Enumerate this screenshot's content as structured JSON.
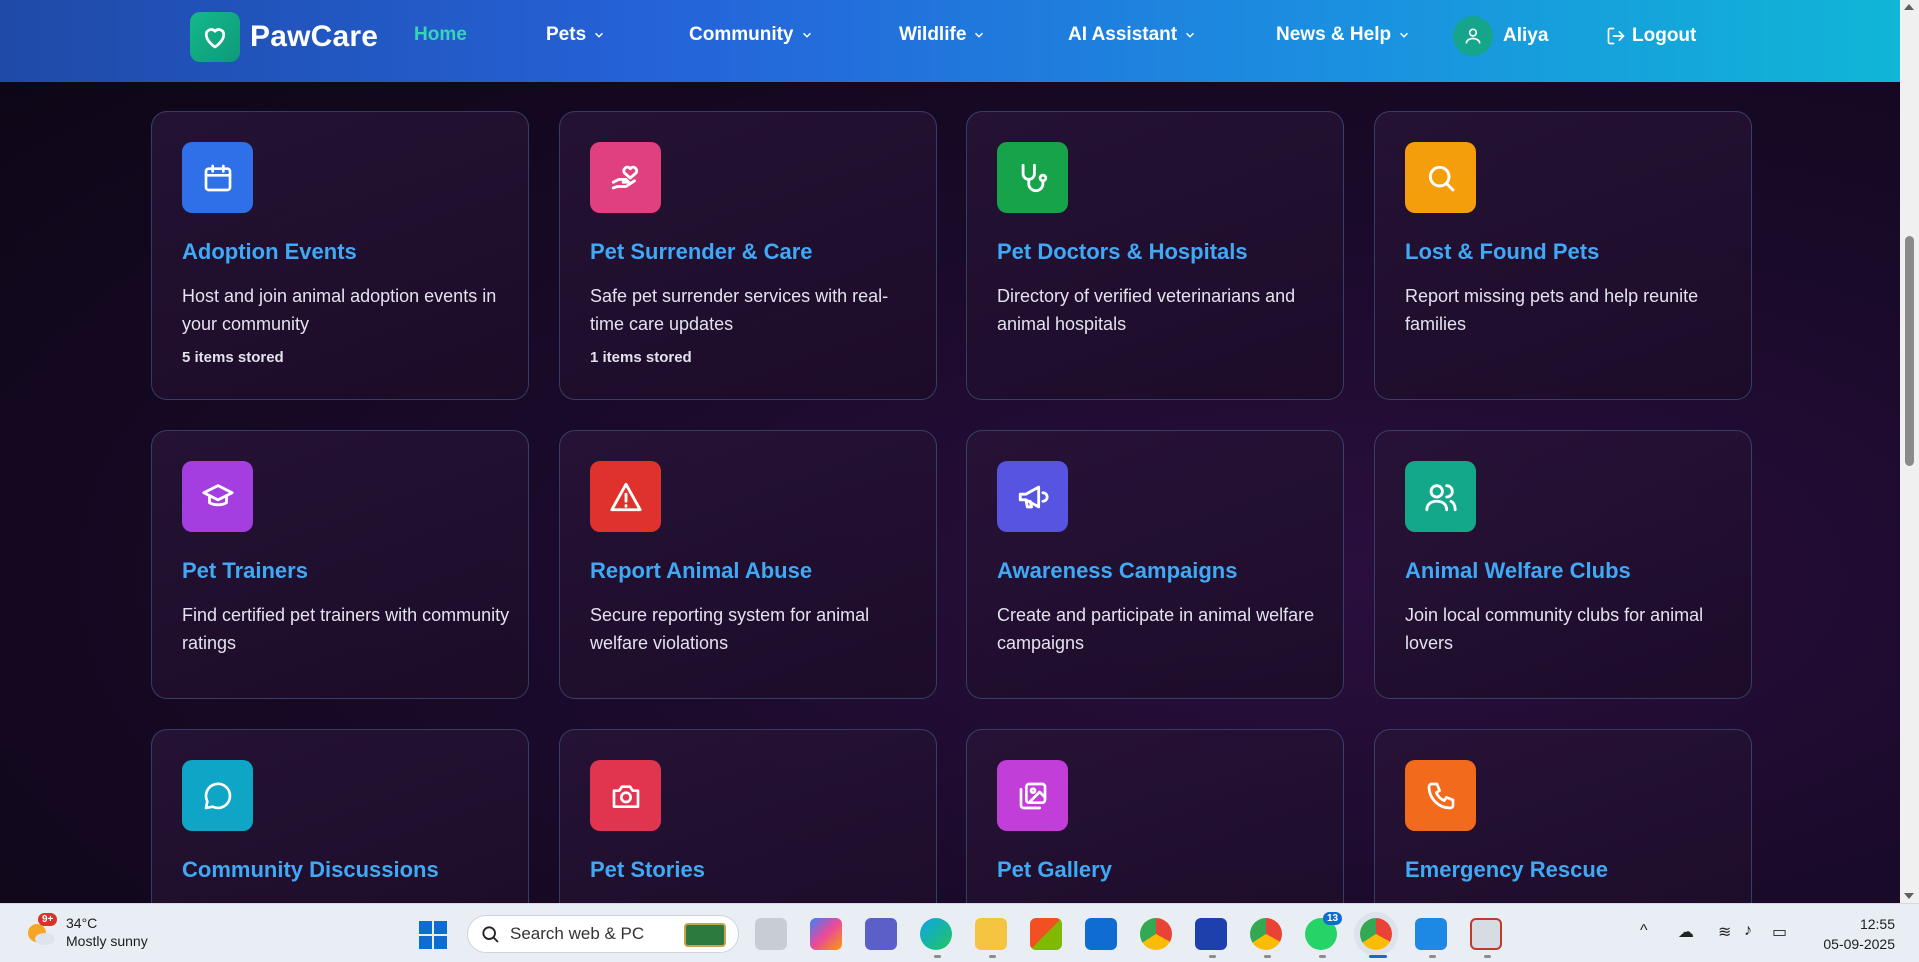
{
  "nav": {
    "brand": "PawCare",
    "items": [
      {
        "label": "Home",
        "active": true
      },
      {
        "label": "Pets"
      },
      {
        "label": "Community"
      },
      {
        "label": "Wildlife"
      },
      {
        "label": "AI Assistant"
      },
      {
        "label": "News & Help"
      }
    ],
    "user": "Aliya",
    "logout": "Logout"
  },
  "cards": [
    {
      "title": "Adoption Events",
      "desc": "Host and join animal adoption events in your community",
      "count": "5 items stored",
      "icon": "calendar-icon",
      "color": "#2f6fe8"
    },
    {
      "title": "Pet Surrender & Care",
      "desc": "Safe pet surrender services with real-time care updates",
      "count": "1 items stored",
      "icon": "heart-hand-icon",
      "color": "#e0407f"
    },
    {
      "title": "Pet Doctors & Hospitals",
      "desc": "Directory of verified veterinarians and animal hospitals",
      "icon": "stethoscope-icon",
      "color": "#16a34a"
    },
    {
      "title": "Lost & Found Pets",
      "desc": "Report missing pets and help reunite families",
      "icon": "search-icon",
      "color": "#f59e0b"
    },
    {
      "title": "Pet Trainers",
      "desc": "Find certified pet trainers with community ratings",
      "icon": "graduation-cap-icon",
      "color": "#a43ee0"
    },
    {
      "title": "Report Animal Abuse",
      "desc": "Secure reporting system for animal welfare violations",
      "icon": "warning-icon",
      "color": "#e0322c"
    },
    {
      "title": "Awareness Campaigns",
      "desc": "Create and participate in animal welfare campaigns",
      "icon": "megaphone-icon",
      "color": "#5654e0"
    },
    {
      "title": "Animal Welfare Clubs",
      "desc": "Join local community clubs for animal lovers",
      "icon": "users-icon",
      "color": "#14a88a"
    },
    {
      "title": "Community Discussions",
      "icon": "chat-icon",
      "color": "#0ea5c6"
    },
    {
      "title": "Pet Stories",
      "icon": "camera-icon",
      "color": "#e0344f"
    },
    {
      "title": "Pet Gallery",
      "icon": "gallery-icon",
      "color": "#c13ed8"
    },
    {
      "title": "Emergency Rescue",
      "icon": "phone-icon",
      "color": "#f26a1b"
    }
  ],
  "taskbar": {
    "weather_badge": "9+",
    "temperature": "34°C",
    "condition": "Mostly sunny",
    "search_placeholder": "Search web & PC",
    "badge_whatsapp": "13",
    "time": "12:55",
    "date": "05-09-2025"
  }
}
